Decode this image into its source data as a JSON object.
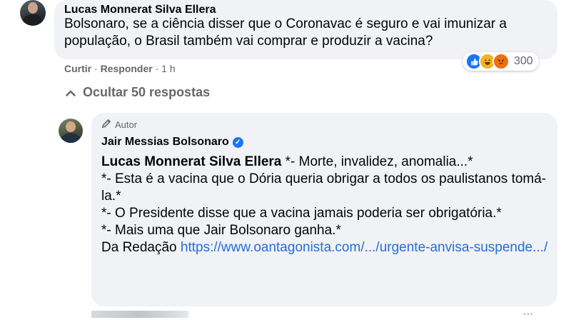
{
  "comment": {
    "author": "Lucas Monnerat Silva Ellera",
    "text": "Bolsonaro, se a ciência disser que o Coronavac é seguro e vai imunizar a população, o Brasil também vai comprar e produzir a vacina?",
    "actions": {
      "like": "Curtir",
      "reply": "Responder",
      "time": "1 h"
    },
    "reactions": {
      "icons": [
        "like-icon",
        "haha-icon",
        "angry-icon"
      ],
      "colors": {
        "like": "#1877f2",
        "haha": "#f7b125",
        "angry": "#e9710f"
      },
      "count": "300"
    }
  },
  "replies_toggle": {
    "label": "Ocultar 50 respostas",
    "icon": "chevron-up-icon"
  },
  "reply": {
    "badge": "Autor",
    "author": "Jair Messias Bolsonaro",
    "verified": true,
    "mention": "Lucas Monnerat Silva Ellera",
    "line1_rest": " *- Morte, invalidez, anomalia...*",
    "line2": "*- Esta é a vacina que o Dória queria obrigar a todos os paulistanos tomá-la.*",
    "line3": "*- O Presidente disse que a vacina jamais poderia ser obrigatória.*",
    "line4": "*- Mais uma que Jair Bolsonaro ganha.*",
    "source_prefix": "Da Redação ",
    "link": "https://www.oantagonista.com/.../urgente-anvisa-suspende.../"
  },
  "colors": {
    "bubble": "#f0f2f5",
    "link": "#216fdb",
    "secondary_text": "#65676b"
  }
}
